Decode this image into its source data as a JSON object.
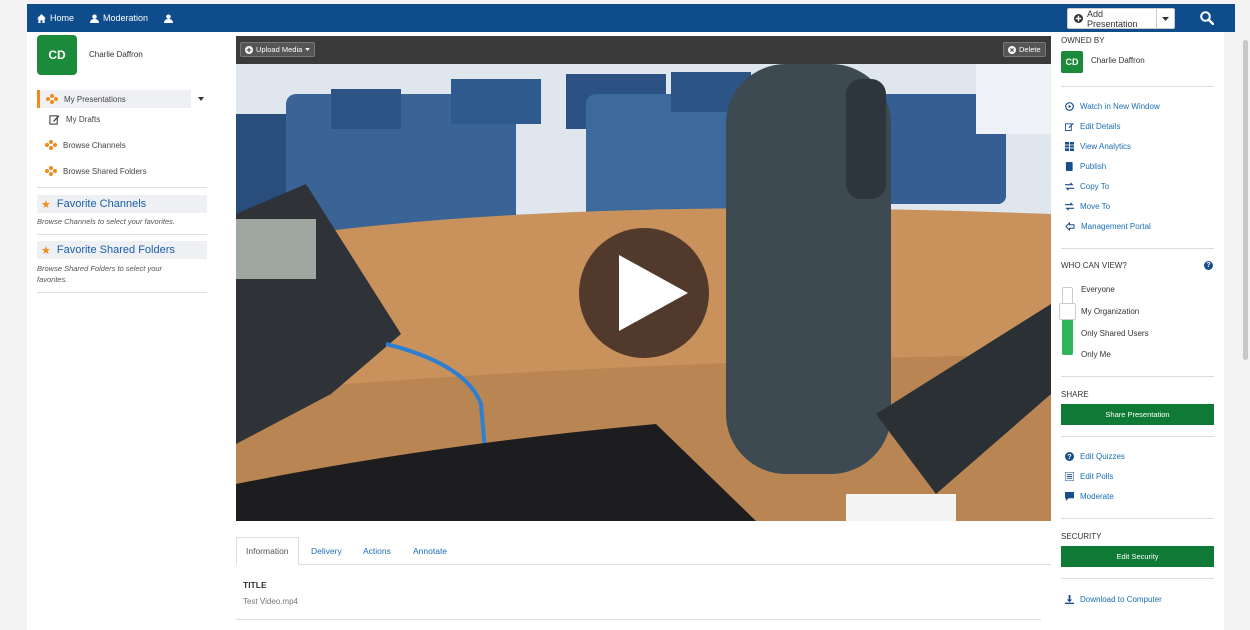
{
  "nav": {
    "home": "Home",
    "moderation": "Moderation",
    "add_presentation": "Add Presentation"
  },
  "user": {
    "initials": "CD",
    "name": "Charlie Daffron"
  },
  "sidebar": {
    "items": [
      {
        "label": "My Presentations"
      },
      {
        "label": "My Drafts"
      },
      {
        "label": "Browse Channels"
      },
      {
        "label": "Browse Shared Folders"
      }
    ],
    "favorite_channels": {
      "title": "Favorite Channels",
      "desc": "Browse Channels to select your favorites."
    },
    "favorite_folders": {
      "title": "Favorite Shared Folders",
      "desc": "Browse Shared Folders to select your favorites."
    }
  },
  "player": {
    "upload_media": "Upload Media",
    "delete": "Delete"
  },
  "tabs": [
    "Information",
    "Delivery",
    "Actions",
    "Annotate"
  ],
  "info": {
    "title_label": "TITLE",
    "title_value": "Test Video.mp4"
  },
  "right": {
    "owned_by": "OWNED BY",
    "owner_initials": "CD",
    "owner_name": "Charlie Daffron",
    "actions": [
      {
        "label": "Watch in New Window",
        "icon": "play-circle-icon"
      },
      {
        "label": "Edit Details",
        "icon": "edit-icon"
      },
      {
        "label": "View Analytics",
        "icon": "table-icon"
      },
      {
        "label": "Publish",
        "icon": "book-icon"
      },
      {
        "label": "Copy To",
        "icon": "exchange-icon"
      },
      {
        "label": "Move To",
        "icon": "exchange-icon"
      },
      {
        "label": "Management Portal",
        "icon": "portal-icon"
      }
    ],
    "who_can_view": "WHO CAN VIEW?",
    "visibility_options": [
      "Everyone",
      "My Organization",
      "Only Shared Users",
      "Only Me"
    ],
    "visibility_selected": "My Organization",
    "visibility_level": 0.45,
    "share": "SHARE",
    "share_button": "Share Presentation",
    "tools": [
      {
        "label": "Edit Quizzes",
        "icon": "question-circle-icon"
      },
      {
        "label": "Edit Polls",
        "icon": "list-icon"
      },
      {
        "label": "Moderate",
        "icon": "comment-icon"
      }
    ],
    "security": "SECURITY",
    "security_button": "Edit Security",
    "download": "Download to Computer"
  },
  "colors": {
    "nav": "#0e4c8c",
    "brand_green": "#0f7a36",
    "accent_orange": "#f08a1c",
    "link_blue": "#1a6fb5"
  }
}
